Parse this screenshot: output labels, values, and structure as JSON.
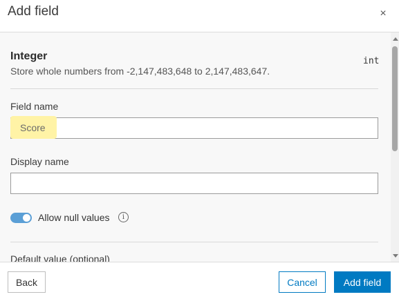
{
  "dialog": {
    "title": "Add field",
    "close_glyph": "×"
  },
  "field_type": {
    "name": "Integer",
    "code": "int",
    "description": "Store whole numbers from -2,147,483,648 to 2,147,483,647."
  },
  "form": {
    "field_name_label": "Field name",
    "field_name_value": "Score",
    "display_name_label": "Display name",
    "display_name_value": "",
    "allow_null_label": "Allow null values",
    "allow_null_enabled": true,
    "default_value_label": "Default value (optional)"
  },
  "footer": {
    "back_label": "Back",
    "cancel_label": "Cancel",
    "add_label": "Add field"
  },
  "colors": {
    "primary": "#007ac2",
    "toggle_on": "#5b9fd6",
    "highlight": "#fff3a6"
  },
  "icons": {
    "close": "close-icon",
    "info": "info-icon"
  }
}
